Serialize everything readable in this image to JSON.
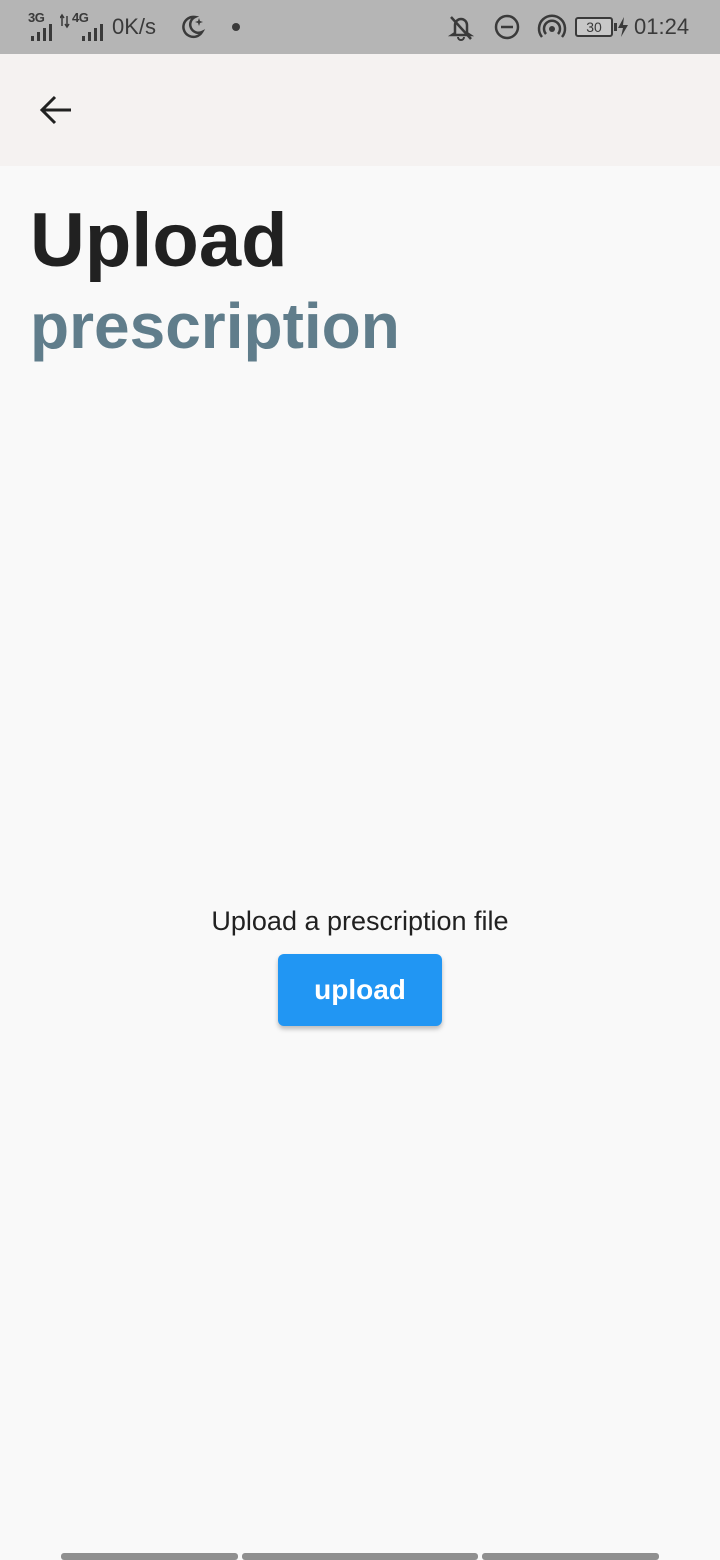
{
  "status_bar": {
    "net_3g": "3G",
    "net_4g": "4G",
    "speed": "0K/s",
    "battery": "30",
    "time": "01:24",
    "icons": [
      "signal-icon",
      "signal-icon",
      "moon-icon",
      "dot-icon",
      "bell-off-icon",
      "do-not-disturb-icon",
      "hotspot-icon",
      "battery-icon",
      "charging-icon"
    ]
  },
  "app_bar": {
    "back_icon": "arrow-back-icon"
  },
  "page": {
    "title_line1": "Upload",
    "title_line2": "prescription",
    "hint": "Upload a prescription file",
    "upload_label": "upload"
  },
  "colors": {
    "status_bar_bg": "#b5b5b5",
    "app_bar_bg": "#f5f2f1",
    "page_bg": "#f9f9f9",
    "title_primary": "#212121",
    "title_accent": "#607d8b",
    "button_bg": "#2196f3",
    "button_text": "#ffffff"
  }
}
